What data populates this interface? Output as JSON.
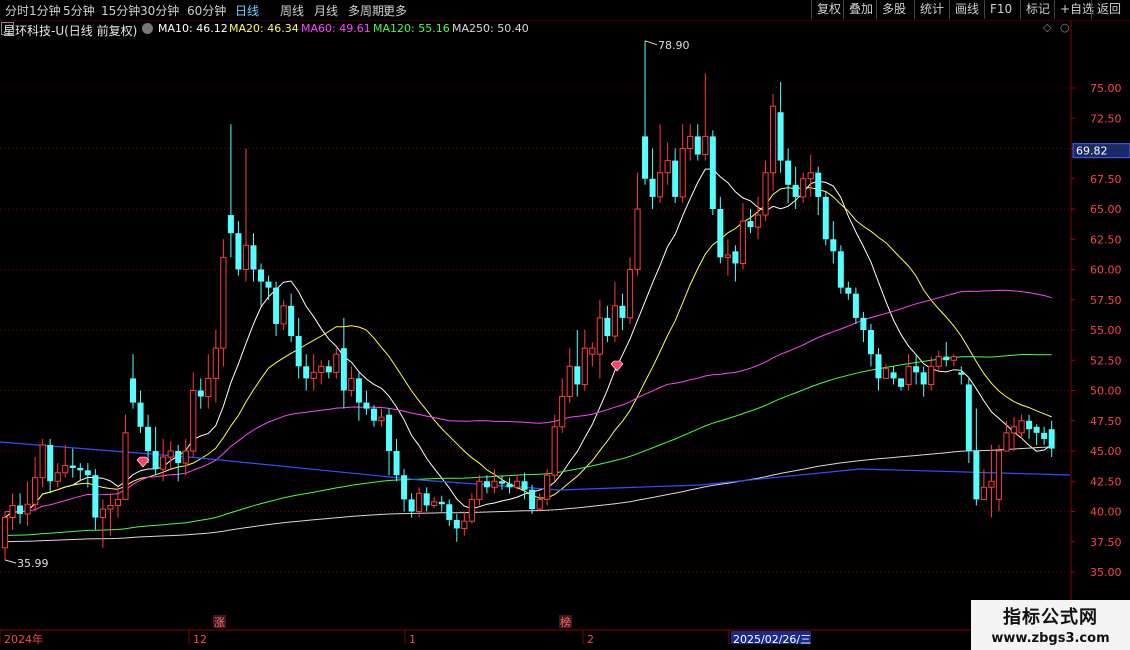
{
  "toolbar": {
    "left_items": [
      "分时",
      "1分钟",
      "5分钟",
      "15分钟",
      "30分钟",
      "60分钟",
      "日线",
      "周线",
      "月线",
      "多周期",
      "更多"
    ],
    "active": "日线",
    "right_items": [
      "复权",
      "叠加",
      "多股",
      "统计",
      "画线",
      "F10",
      "标记",
      "+自选",
      "返回"
    ]
  },
  "legend": {
    "title": "星环科技-U(日线 前复权)",
    "ma": [
      {
        "label": "MA10: 46.12",
        "color": "#ffffff"
      },
      {
        "label": "MA20: 46.34",
        "color": "#ffff44"
      },
      {
        "label": "MA60: 49.61",
        "color": "#ff44ff"
      },
      {
        "label": "MA120: 55.16",
        "color": "#44ff44"
      },
      {
        "label": "MA250: 50.40",
        "color": "#d8d8d8"
      }
    ]
  },
  "chart_data": {
    "type": "candlestick",
    "yaxis_ticks": [
      "75.00",
      "72.50",
      "70.00",
      "67.50",
      "65.00",
      "62.50",
      "60.00",
      "57.50",
      "55.00",
      "52.50",
      "50.00",
      "47.50",
      "45.00",
      "42.50",
      "40.00",
      "37.50",
      "35.00"
    ],
    "price_marker": "69.82",
    "high_label": "78.90",
    "low_label": "35.99",
    "x_labels": [
      "2024年",
      "12",
      "1",
      "2",
      "2025/02/26/三"
    ],
    "markers": [
      "涨",
      "榜"
    ],
    "up_color": "#ff3c3c",
    "down_color": "#54ffff",
    "candles": [
      [
        37,
        39.5,
        35.99,
        40
      ],
      [
        39.5,
        40.5,
        38.5,
        41.5
      ],
      [
        40.5,
        39.8,
        39,
        41.5
      ],
      [
        39.8,
        40.6,
        38.8,
        42.5
      ],
      [
        40.6,
        42.8,
        40,
        44.5
      ],
      [
        42.8,
        45.5,
        42,
        46
      ],
      [
        45.5,
        42.5,
        41.5,
        46
      ],
      [
        42.5,
        43.2,
        42,
        44
      ],
      [
        43.2,
        43.8,
        42.8,
        45.5
      ],
      [
        43.8,
        43.6,
        42.8,
        45.2
      ],
      [
        43.6,
        43.4,
        42.5,
        44
      ],
      [
        43.4,
        43.0,
        42,
        44
      ],
      [
        43,
        39.5,
        38.5,
        43.5
      ],
      [
        39.5,
        40.2,
        37,
        41
      ],
      [
        40.2,
        40.5,
        38,
        41.5
      ],
      [
        40.5,
        41,
        39.5,
        42
      ],
      [
        41,
        46.5,
        41,
        48
      ],
      [
        51,
        49,
        48.5,
        53
      ],
      [
        49,
        47,
        46.5,
        50
      ],
      [
        47,
        45,
        44,
        48
      ],
      [
        45,
        43.5,
        43,
        47
      ],
      [
        43.5,
        44.5,
        42.5,
        46
      ],
      [
        44.5,
        45,
        43.5,
        45.8
      ],
      [
        45,
        44,
        42.5,
        45.5
      ],
      [
        44,
        45,
        43,
        46
      ],
      [
        45,
        50,
        44.5,
        51.5
      ],
      [
        50,
        49.5,
        48.5,
        51
      ],
      [
        49.5,
        51,
        48.5,
        53
      ],
      [
        51,
        53.5,
        49,
        55
      ],
      [
        53.5,
        61,
        52,
        62.5
      ],
      [
        64.5,
        63,
        61,
        72
      ],
      [
        63,
        60,
        59.5,
        64
      ],
      [
        60,
        62,
        59,
        70
      ],
      [
        62,
        60,
        59,
        63
      ],
      [
        60,
        59,
        57,
        60.5
      ],
      [
        59,
        58.5,
        57.5,
        59.5
      ],
      [
        58.5,
        55.5,
        54.5,
        59
      ],
      [
        55.5,
        57,
        55,
        57.5
      ],
      [
        57,
        54.5,
        54,
        58
      ],
      [
        54.5,
        52,
        51,
        56
      ],
      [
        52,
        51,
        50,
        53
      ],
      [
        51,
        51.5,
        50,
        53
      ],
      [
        51.5,
        52,
        50.5,
        52.5
      ],
      [
        52,
        51.5,
        51,
        52.5
      ],
      [
        51.5,
        53,
        51,
        53.5
      ],
      [
        53.5,
        50,
        48.5,
        56
      ],
      [
        50,
        51,
        49.5,
        52
      ],
      [
        51,
        49,
        47.5,
        51.5
      ],
      [
        49,
        48.5,
        48,
        50
      ],
      [
        48.5,
        47.5,
        47,
        48.8
      ],
      [
        47.5,
        47.8,
        47,
        48.5
      ],
      [
        48,
        45,
        43,
        48.5
      ],
      [
        45,
        43,
        42.5,
        46
      ],
      [
        43,
        41,
        40,
        43.5
      ],
      [
        41,
        40,
        39.5,
        41.5
      ],
      [
        40,
        41.5,
        39.5,
        42
      ],
      [
        41.5,
        40.5,
        40,
        42
      ],
      [
        40.5,
        40.8,
        40.3,
        41.2
      ],
      [
        40.8,
        40.6,
        40,
        41.3
      ],
      [
        40.6,
        39.3,
        38.8,
        41
      ],
      [
        39.3,
        38.6,
        37.5,
        39.8
      ],
      [
        38.6,
        39.2,
        38,
        40
      ],
      [
        39.2,
        41,
        39,
        41.5
      ],
      [
        41,
        42.5,
        40.5,
        43
      ],
      [
        42.5,
        42,
        41.5,
        43
      ],
      [
        42,
        42.5,
        41.5,
        43.5
      ],
      [
        42.5,
        42.3,
        41.8,
        43
      ],
      [
        42.3,
        42,
        41.5,
        42.8
      ],
      [
        42,
        42.5,
        41.8,
        43
      ],
      [
        42.5,
        41.8,
        41,
        43.2
      ],
      [
        41.8,
        40.2,
        39.8,
        42.2
      ],
      [
        40.2,
        41,
        40,
        41.5
      ],
      [
        41,
        43,
        40.5,
        43.5
      ],
      [
        43,
        47,
        42.5,
        48
      ],
      [
        47,
        49.5,
        46.5,
        51
      ],
      [
        49.5,
        52,
        49,
        53.5
      ],
      [
        52,
        50.5,
        49.5,
        55
      ],
      [
        50.5,
        53.5,
        50,
        55
      ],
      [
        53,
        53.5,
        52,
        54
      ],
      [
        53,
        56,
        51,
        57.5
      ],
      [
        56,
        54.5,
        54,
        57
      ],
      [
        54.5,
        57,
        54,
        59
      ],
      [
        57,
        56,
        55,
        58
      ],
      [
        56,
        60,
        55.5,
        61
      ],
      [
        60,
        65,
        59.5,
        68
      ],
      [
        71,
        67.5,
        67,
        78.9
      ],
      [
        67.5,
        66,
        65,
        70
      ],
      [
        66,
        68,
        65.5,
        72
      ],
      [
        68,
        69,
        67,
        70.5
      ],
      [
        69,
        66,
        65.5,
        70
      ],
      [
        66,
        70,
        65.5,
        72
      ],
      [
        70,
        71,
        69,
        72
      ],
      [
        71,
        69.5,
        69,
        72
      ],
      [
        69.5,
        71,
        69,
        76.2
      ],
      [
        71,
        65,
        64.5,
        71.5
      ],
      [
        65,
        61,
        60.5,
        66
      ],
      [
        61,
        61.2,
        59.5,
        62.5
      ],
      [
        61.5,
        60.5,
        59,
        62
      ],
      [
        60.5,
        64,
        60,
        65.5
      ],
      [
        64,
        63.5,
        63,
        65
      ],
      [
        63.5,
        64.5,
        62.5,
        66
      ],
      [
        64.5,
        68,
        64,
        69
      ],
      [
        68,
        73.5,
        66.5,
        74.5
      ],
      [
        73,
        69,
        68,
        75.5
      ],
      [
        69,
        67,
        65.5,
        70
      ],
      [
        67,
        66,
        65,
        68.5
      ],
      [
        66,
        67.5,
        65.5,
        68
      ],
      [
        67.5,
        68,
        66,
        69.5
      ],
      [
        68,
        66,
        64.5,
        68.5
      ],
      [
        66,
        62.5,
        62,
        66.5
      ],
      [
        62.5,
        61.5,
        60.5,
        64
      ],
      [
        61.5,
        58.5,
        58,
        62
      ],
      [
        58.5,
        58,
        57.5,
        59
      ],
      [
        58,
        56,
        55.5,
        58.5
      ],
      [
        56,
        55,
        54,
        56.5
      ],
      [
        55,
        53,
        52,
        55.5
      ],
      [
        53,
        51,
        50,
        53.5
      ],
      [
        51,
        51.8,
        51,
        52.2
      ],
      [
        51.5,
        51,
        50.5,
        52
      ],
      [
        51,
        50.3,
        50,
        51
      ],
      [
        50.5,
        52,
        50,
        53
      ],
      [
        52,
        51.5,
        50.5,
        53
      ],
      [
        51.5,
        50.5,
        49.5,
        52
      ],
      [
        50.5,
        52,
        50,
        52.8
      ],
      [
        52,
        52.8,
        51.5,
        53.3
      ],
      [
        52.8,
        52.5,
        52,
        54
      ],
      [
        52.5,
        52.8,
        52,
        53
      ],
      [
        51.5,
        51.3,
        50.5,
        52
      ],
      [
        50.5,
        45,
        44,
        51
      ],
      [
        45,
        41,
        40.5,
        48.5
      ],
      [
        41,
        42,
        41.5,
        43.5
      ],
      [
        42,
        42.5,
        39.5,
        45.5
      ],
      [
        41,
        45,
        40,
        45.5
      ],
      [
        45,
        46.5,
        45.5,
        47.5
      ],
      [
        46.5,
        47,
        45,
        47.8
      ],
      [
        46.5,
        47.5,
        46,
        48
      ],
      [
        47.5,
        46.8,
        46,
        48
      ],
      [
        47,
        46.5,
        45.5,
        47.2
      ],
      [
        46.5,
        46,
        45.5,
        47
      ],
      [
        46.8,
        45.2,
        44.5,
        47.5
      ]
    ]
  }
}
